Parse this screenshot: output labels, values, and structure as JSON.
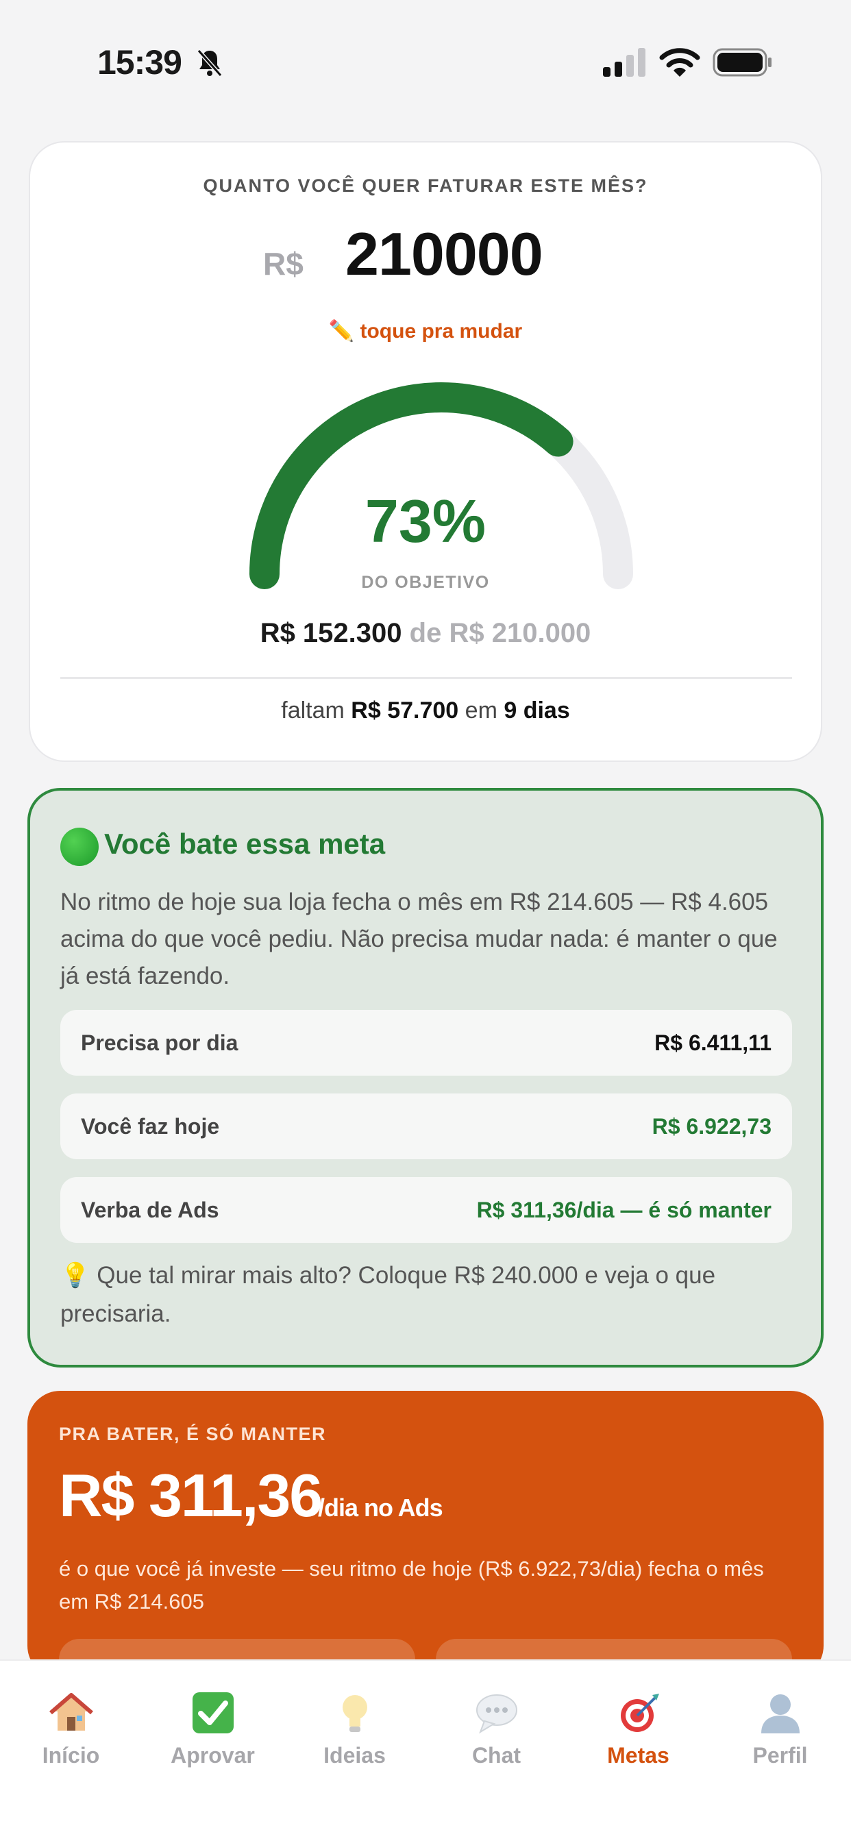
{
  "status_bar": {
    "time": "15:39"
  },
  "goal": {
    "question": "QUANTO VOCÊ QUER FATURAR ESTE MÊS?",
    "currency": "R$",
    "value": "210000",
    "edit_label": "✏️ toque pra mudar",
    "progress_fraction": 0.73,
    "percent_label": "73%",
    "percent_caption": "DO OBJETIVO",
    "achieved": "R$ 152.300",
    "of_word": "de",
    "target": "R$ 210.000",
    "remaining_prefix": "faltam",
    "remaining_amount": "R$ 57.700",
    "remaining_mid": "em",
    "remaining_days": "9 dias"
  },
  "verdict": {
    "title": "Você bate essa meta",
    "text": "No ritmo de hoje sua loja fecha o mês em R$ 214.605 — R$ 4.605 acima do que você pediu. Não precisa mudar nada: é manter o que já está fazendo.",
    "rows": [
      {
        "label": "Precisa por dia",
        "value": "R$ 6.411,11"
      },
      {
        "label": "Você faz hoje",
        "value": "R$ 6.922,73"
      },
      {
        "label": "Verba de Ads",
        "value": "R$ 311,36/dia — é só manter"
      }
    ],
    "tip": "💡 Que tal mirar mais alto? Coloque R$ 240.000 e veja o que precisaria."
  },
  "ads": {
    "kicker": "PRA BATER, É SÓ MANTER",
    "amount": "R$ 311,36",
    "unit": "/dia no Ads",
    "description": "é o que você já investe — seu ritmo de hoje (R$ 6.922,73/dia) fecha o mês em R$ 214.605"
  },
  "tabs": [
    {
      "label": "Início",
      "icon": "house-icon"
    },
    {
      "label": "Aprovar",
      "icon": "checkbox-icon"
    },
    {
      "label": "Ideias",
      "icon": "lightbulb-icon"
    },
    {
      "label": "Chat",
      "icon": "speech-bubble-icon"
    },
    {
      "label": "Metas",
      "icon": "target-icon",
      "active": true
    },
    {
      "label": "Perfil",
      "icon": "person-icon"
    }
  ],
  "colors": {
    "accent_orange": "#d4520f",
    "success_green": "#237a34",
    "gauge_track": "#ececef"
  }
}
